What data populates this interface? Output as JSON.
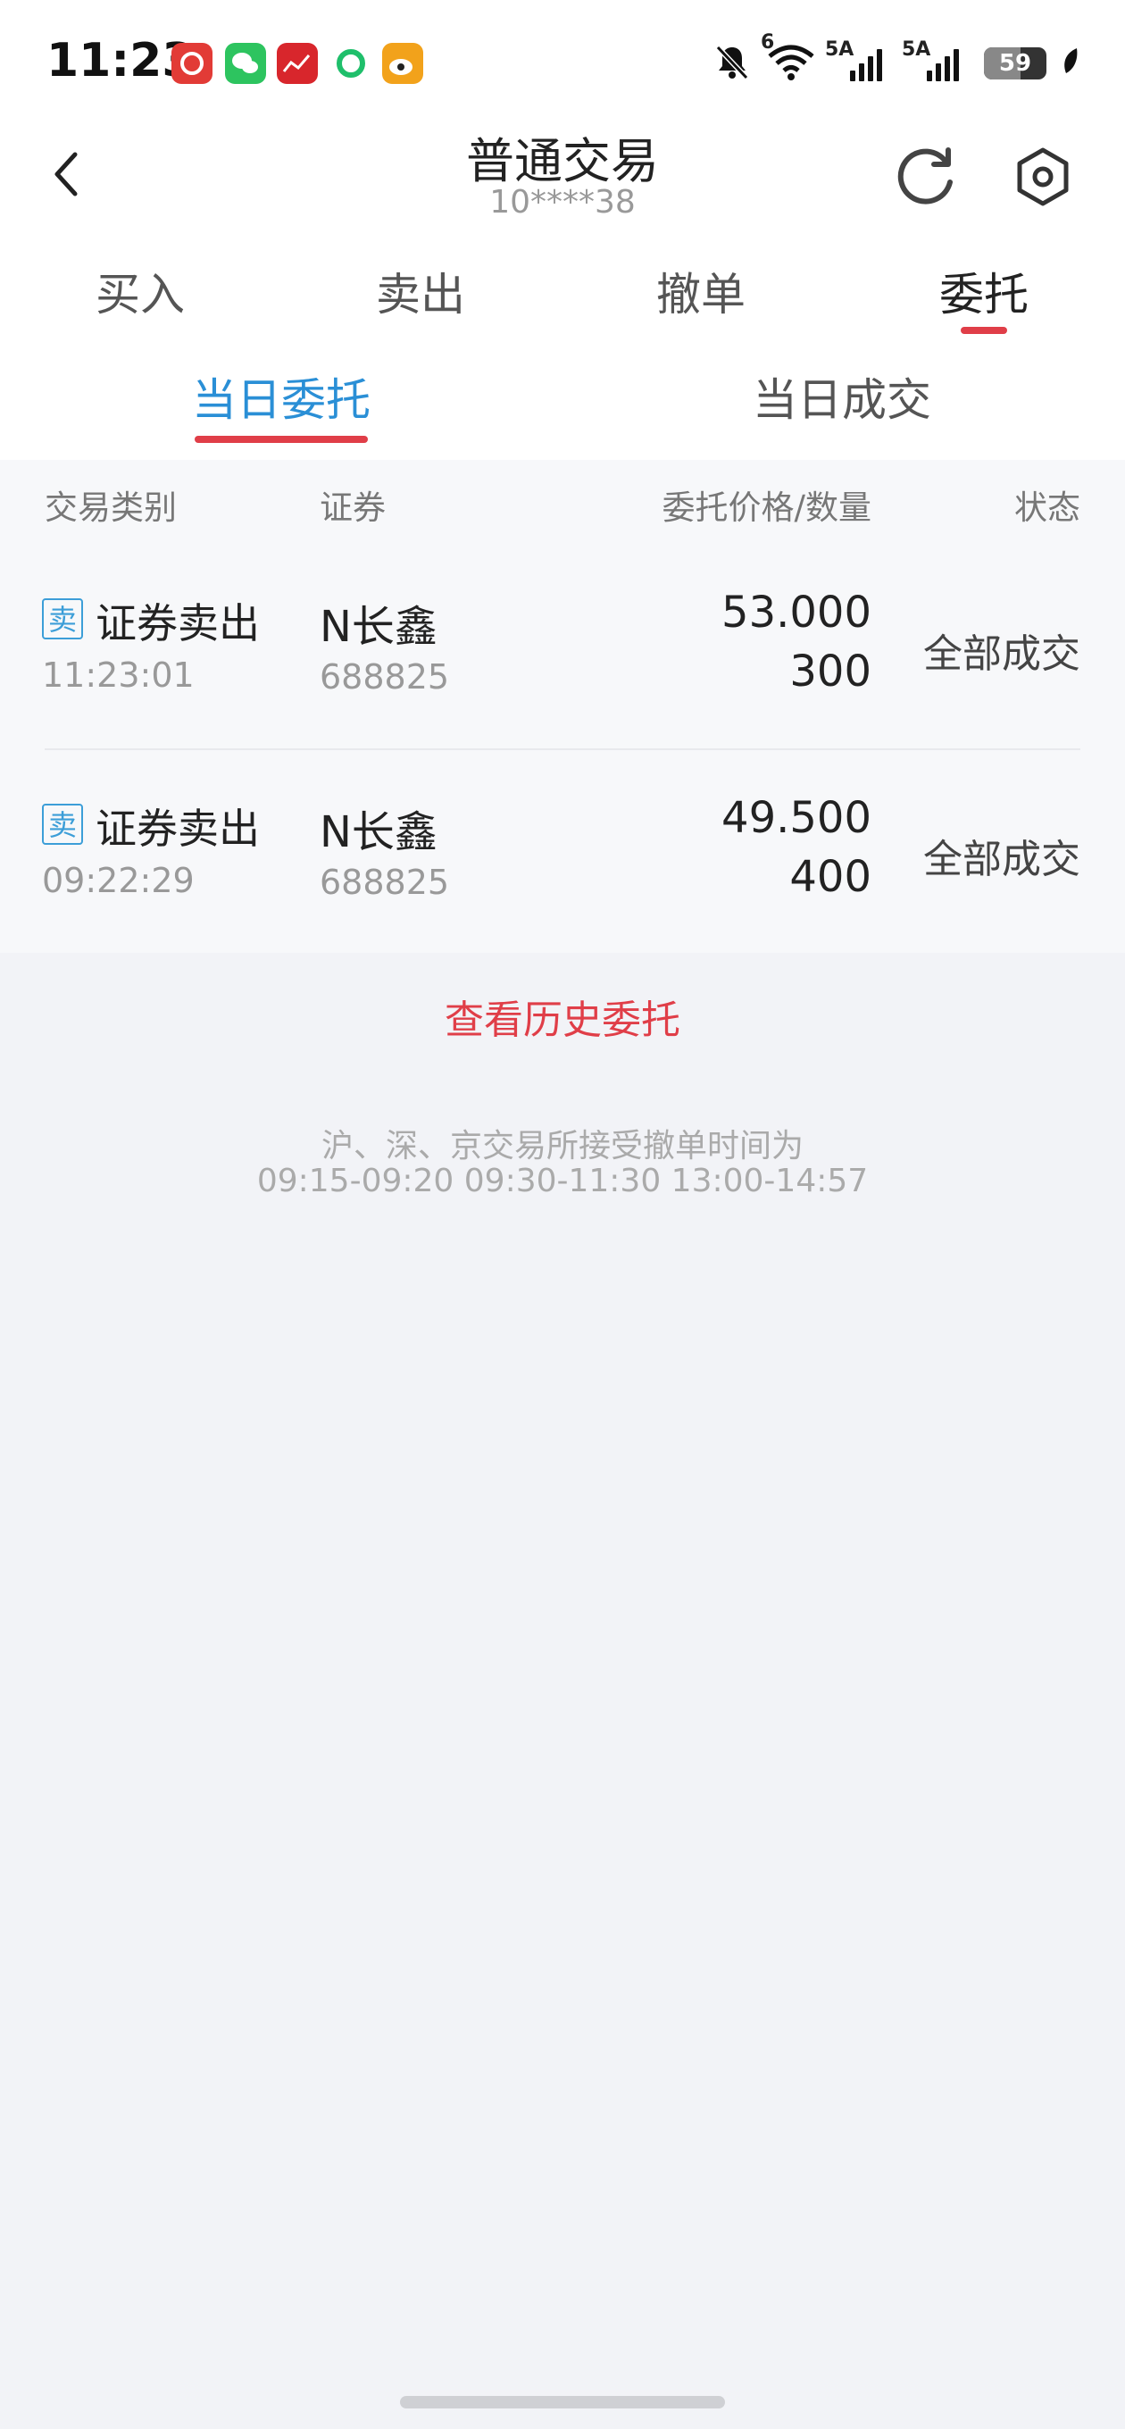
{
  "status_bar": {
    "time": "11:23",
    "signal1_label": "5A",
    "signal2_label": "5A",
    "battery": "59",
    "battery_level": 0.59,
    "wifi_label": "6",
    "notif_colors": [
      "#e23b36",
      "#2dc45f",
      "#d8262c",
      "#1fbf6b",
      "#f2a21b"
    ]
  },
  "header": {
    "title": "普通交易",
    "account": "10****38"
  },
  "tabs": [
    "买入",
    "卖出",
    "撤单",
    "委托"
  ],
  "subtabs": [
    "当日委托",
    "当日成交"
  ],
  "table": {
    "headers": [
      "交易类别",
      "证券",
      "委托价格/数量",
      "状态"
    ],
    "rows": [
      {
        "badge": "卖",
        "type": "证券卖出",
        "time": "11:23:01",
        "name": "N长鑫",
        "code": "688825",
        "price": "53.000",
        "qty": "300",
        "status": "全部成交"
      },
      {
        "badge": "卖",
        "type": "证券卖出",
        "time": "09:22:29",
        "name": "N长鑫",
        "code": "688825",
        "price": "49.500",
        "qty": "400",
        "status": "全部成交"
      }
    ]
  },
  "history_link": "查看历史委托",
  "notice": {
    "line1": "沪、深、京交易所接受撤单时间为",
    "line2": "09:15-09:20  09:30-11:30  13:00-14:57"
  },
  "colors": {
    "accent_red": "#e03e48",
    "accent_blue": "#2a8fd6"
  }
}
